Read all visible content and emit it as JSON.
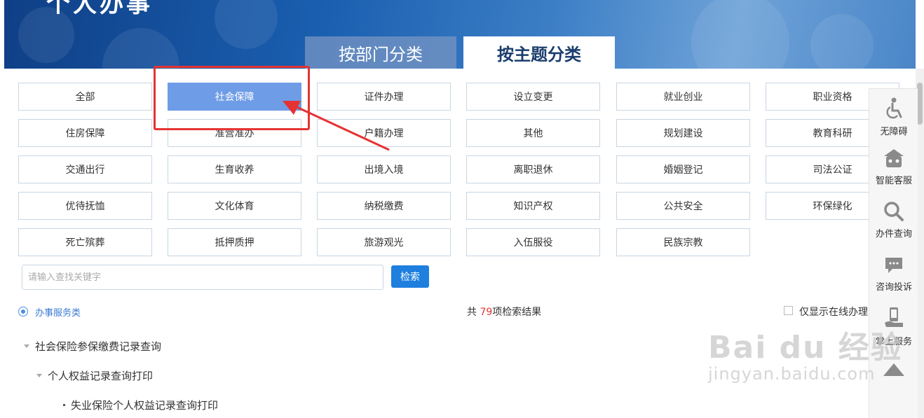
{
  "header": {
    "title": "个人办事",
    "tabs": [
      {
        "label": "按部门分类",
        "active": false
      },
      {
        "label": "按主题分类",
        "active": true
      }
    ]
  },
  "categories": [
    "全部",
    "社会保障",
    "证件办理",
    "设立变更",
    "就业创业",
    "职业资格",
    "住房保障",
    "准营准办",
    "户籍办理",
    "其他",
    "规划建设",
    "教育科研",
    "交通出行",
    "生育收养",
    "出境入境",
    "离职退休",
    "婚姻登记",
    "司法公证",
    "优待抚恤",
    "文化体育",
    "纳税缴费",
    "知识产权",
    "公共安全",
    "环保绿化",
    "死亡殡葬",
    "抵押质押",
    "旅游观光",
    "入伍服役",
    "民族宗教"
  ],
  "active_category": "社会保障",
  "search": {
    "placeholder": "请输入查找关键字",
    "button_label": "检索"
  },
  "filter": {
    "radio_label": "办事服务类",
    "count_prefix": "共 ",
    "count": "79",
    "count_suffix": "项检索结果",
    "online_only_label": "仅显示在线办理"
  },
  "tree": [
    {
      "label": "社会保险参保缴费记录查询",
      "level": 0
    },
    {
      "label": "个人权益记录查询打印",
      "level": 1
    },
    {
      "label": "失业保险个人权益记录查询打印",
      "level": 2
    }
  ],
  "sidebar": {
    "items": [
      {
        "label": "无障碍",
        "icon": "wheelchair-icon"
      },
      {
        "label": "智能客服",
        "icon": "robot-icon"
      },
      {
        "label": "办件查询",
        "icon": "search-icon"
      },
      {
        "label": "咨询投诉",
        "icon": "chat-icon"
      },
      {
        "label": "掌上服务",
        "icon": "mobile-hand-icon"
      }
    ]
  },
  "watermark": {
    "main": "Bai du 经验",
    "sub": "jingyan.baidu.com"
  },
  "colors": {
    "active_category": "#6f9ce6",
    "search_button": "#1e7fde",
    "highlight": "#e53333",
    "link_blue": "#3a7bd5"
  }
}
